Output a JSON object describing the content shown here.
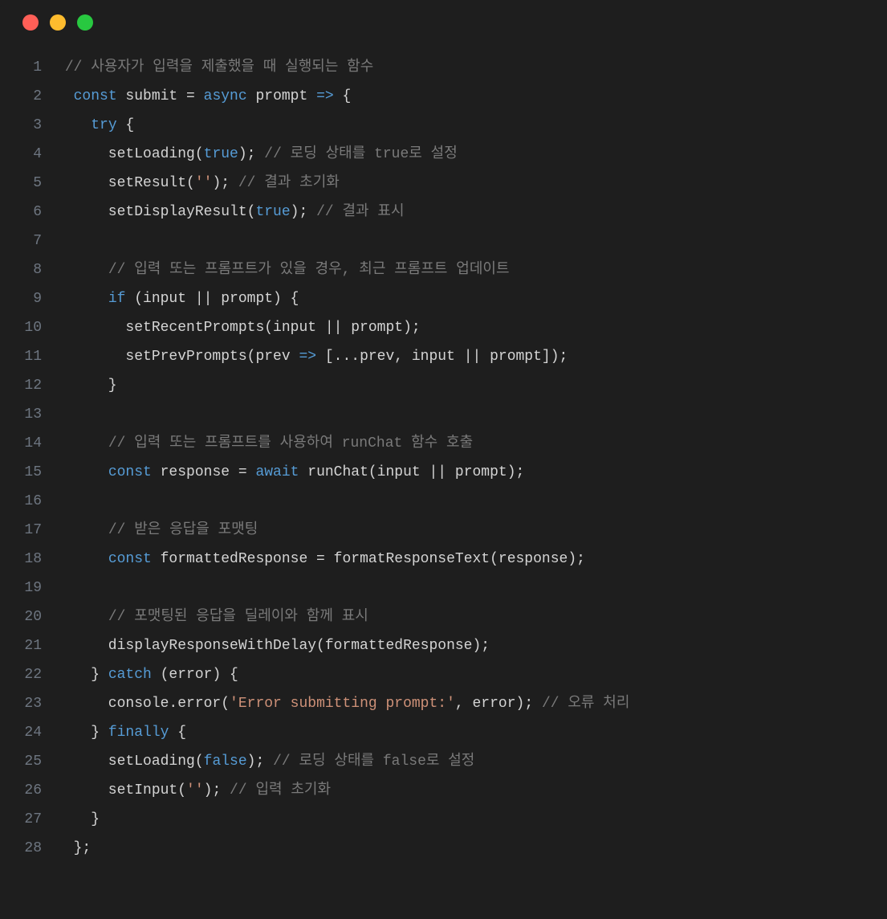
{
  "colors": {
    "background": "#1e1e1e",
    "traffic_red": "#ff5f57",
    "traffic_yellow": "#febc2e",
    "traffic_green": "#28c840",
    "gutter": "#6e7681",
    "comment": "#7a7a7a",
    "keyword": "#569cd6",
    "string": "#ce9178",
    "default": "#d4d4d4"
  },
  "lineNumbers": [
    "1",
    "2",
    "3",
    "4",
    "5",
    "6",
    "7",
    "8",
    "9",
    "10",
    "11",
    "12",
    "13",
    "14",
    "15",
    "16",
    "17",
    "18",
    "19",
    "20",
    "21",
    "22",
    "23",
    "24",
    "25",
    "26",
    "27",
    "28"
  ],
  "code": [
    [
      {
        "t": " ",
        "c": "default"
      },
      {
        "t": "// 사용자가 입력을 제출했을 때 실행되는 함수",
        "c": "comment"
      }
    ],
    [
      {
        "t": "  ",
        "c": "default"
      },
      {
        "t": "const",
        "c": "keyword"
      },
      {
        "t": " submit = ",
        "c": "default"
      },
      {
        "t": "async",
        "c": "keyword"
      },
      {
        "t": " prompt ",
        "c": "default"
      },
      {
        "t": "=>",
        "c": "keyword"
      },
      {
        "t": " {",
        "c": "default"
      }
    ],
    [
      {
        "t": "    ",
        "c": "default"
      },
      {
        "t": "try",
        "c": "keyword"
      },
      {
        "t": " {",
        "c": "default"
      }
    ],
    [
      {
        "t": "      setLoading(",
        "c": "default"
      },
      {
        "t": "true",
        "c": "boolean"
      },
      {
        "t": "); ",
        "c": "default"
      },
      {
        "t": "// 로딩 상태를 true로 설정",
        "c": "comment"
      }
    ],
    [
      {
        "t": "      setResult(",
        "c": "default"
      },
      {
        "t": "''",
        "c": "string"
      },
      {
        "t": "); ",
        "c": "default"
      },
      {
        "t": "// 결과 초기화",
        "c": "comment"
      }
    ],
    [
      {
        "t": "      setDisplayResult(",
        "c": "default"
      },
      {
        "t": "true",
        "c": "boolean"
      },
      {
        "t": "); ",
        "c": "default"
      },
      {
        "t": "// 결과 표시",
        "c": "comment"
      }
    ],
    [
      {
        "t": "",
        "c": "default"
      }
    ],
    [
      {
        "t": "      ",
        "c": "default"
      },
      {
        "t": "// 입력 또는 프롬프트가 있을 경우, 최근 프롬프트 업데이트",
        "c": "comment"
      }
    ],
    [
      {
        "t": "      ",
        "c": "default"
      },
      {
        "t": "if",
        "c": "keyword"
      },
      {
        "t": " (input || prompt) {",
        "c": "default"
      }
    ],
    [
      {
        "t": "        setRecentPrompts(input || prompt);",
        "c": "default"
      }
    ],
    [
      {
        "t": "        setPrevPrompts(prev ",
        "c": "default"
      },
      {
        "t": "=>",
        "c": "keyword"
      },
      {
        "t": " [...prev, input || prompt]);",
        "c": "default"
      }
    ],
    [
      {
        "t": "      }",
        "c": "default"
      }
    ],
    [
      {
        "t": "",
        "c": "default"
      }
    ],
    [
      {
        "t": "      ",
        "c": "default"
      },
      {
        "t": "// 입력 또는 프롬프트를 사용하여 runChat 함수 호출",
        "c": "comment"
      }
    ],
    [
      {
        "t": "      ",
        "c": "default"
      },
      {
        "t": "const",
        "c": "keyword"
      },
      {
        "t": " response = ",
        "c": "default"
      },
      {
        "t": "await",
        "c": "keyword"
      },
      {
        "t": " runChat(input || prompt);",
        "c": "default"
      }
    ],
    [
      {
        "t": "",
        "c": "default"
      }
    ],
    [
      {
        "t": "      ",
        "c": "default"
      },
      {
        "t": "// 받은 응답을 포맷팅",
        "c": "comment"
      }
    ],
    [
      {
        "t": "      ",
        "c": "default"
      },
      {
        "t": "const",
        "c": "keyword"
      },
      {
        "t": " formattedResponse = formatResponseText(response);",
        "c": "default"
      }
    ],
    [
      {
        "t": "",
        "c": "default"
      }
    ],
    [
      {
        "t": "      ",
        "c": "default"
      },
      {
        "t": "// 포맷팅된 응답을 딜레이와 함께 표시",
        "c": "comment"
      }
    ],
    [
      {
        "t": "      displayResponseWithDelay(formattedResponse);",
        "c": "default"
      }
    ],
    [
      {
        "t": "    } ",
        "c": "default"
      },
      {
        "t": "catch",
        "c": "keyword"
      },
      {
        "t": " (error) {",
        "c": "default"
      }
    ],
    [
      {
        "t": "      console.error(",
        "c": "default"
      },
      {
        "t": "'Error submitting prompt:'",
        "c": "string"
      },
      {
        "t": ", error); ",
        "c": "default"
      },
      {
        "t": "// 오류 처리",
        "c": "comment"
      }
    ],
    [
      {
        "t": "    } ",
        "c": "default"
      },
      {
        "t": "finally",
        "c": "keyword"
      },
      {
        "t": " {",
        "c": "default"
      }
    ],
    [
      {
        "t": "      setLoading(",
        "c": "default"
      },
      {
        "t": "false",
        "c": "boolean"
      },
      {
        "t": "); ",
        "c": "default"
      },
      {
        "t": "// 로딩 상태를 false로 설정",
        "c": "comment"
      }
    ],
    [
      {
        "t": "      setInput(",
        "c": "default"
      },
      {
        "t": "''",
        "c": "string"
      },
      {
        "t": "); ",
        "c": "default"
      },
      {
        "t": "// 입력 초기화",
        "c": "comment"
      }
    ],
    [
      {
        "t": "    }",
        "c": "default"
      }
    ],
    [
      {
        "t": "  };",
        "c": "default"
      }
    ]
  ]
}
